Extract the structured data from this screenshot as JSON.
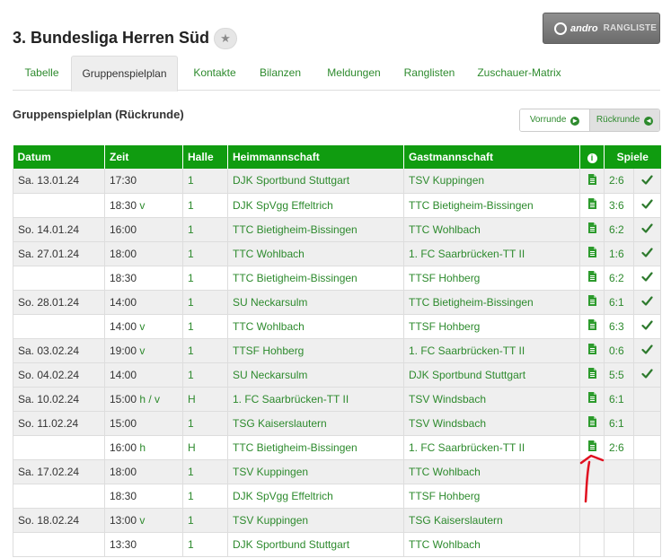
{
  "header": {
    "title": "3. Bundesliga Herren Süd",
    "favorite_glyph": "★",
    "brand_name": "andro",
    "brand_sub": "RANGLISTE"
  },
  "tabs": [
    {
      "label": "Tabelle"
    },
    {
      "label": "Gruppenspielplan"
    },
    {
      "label": "Kontakte"
    },
    {
      "label": "Bilanzen"
    },
    {
      "label": "Meldungen"
    },
    {
      "label": "Ranglisten"
    },
    {
      "label": "Zuschauer-Matrix"
    }
  ],
  "section": {
    "title": "Gruppenspielplan (Rückrunde)",
    "vorrunde": "Vorrunde",
    "rueckrunde": "Rückrunde"
  },
  "table": {
    "headers": {
      "datum": "Datum",
      "zeit": "Zeit",
      "halle": "Halle",
      "heim": "Heimmannschaft",
      "gast": "Gastmannschaft",
      "info": "i",
      "spiele": "Spiele"
    },
    "rows": [
      {
        "date": "Sa. 13.01.24",
        "time": "17:30",
        "flag": "",
        "halle": "1",
        "home": "DJK Sportbund Stuttgart",
        "away": "TSV Kuppingen",
        "report": true,
        "score": "2:6",
        "checked": true
      },
      {
        "date": "",
        "time": "18:30",
        "flag": "v",
        "halle": "1",
        "home": "DJK SpVgg Effeltrich",
        "away": "TTC Bietigheim-Bissingen",
        "report": true,
        "score": "3:6",
        "checked": true
      },
      {
        "date": "So. 14.01.24",
        "time": "16:00",
        "flag": "",
        "halle": "1",
        "home": "TTC Bietigheim-Bissingen",
        "away": "TTC Wohlbach",
        "report": true,
        "score": "6:2",
        "checked": true
      },
      {
        "date": "Sa. 27.01.24",
        "time": "18:00",
        "flag": "",
        "halle": "1",
        "home": "TTC Wohlbach",
        "away": "1. FC Saarbrücken-TT II",
        "report": true,
        "score": "1:6",
        "checked": true
      },
      {
        "date": "",
        "time": "18:30",
        "flag": "",
        "halle": "1",
        "home": "TTC Bietigheim-Bissingen",
        "away": "TTSF Hohberg",
        "report": true,
        "score": "6:2",
        "checked": true
      },
      {
        "date": "So. 28.01.24",
        "time": "14:00",
        "flag": "",
        "halle": "1",
        "home": "SU Neckarsulm",
        "away": "TTC Bietigheim-Bissingen",
        "report": true,
        "score": "6:1",
        "checked": true
      },
      {
        "date": "",
        "time": "14:00",
        "flag": "v",
        "halle": "1",
        "home": "TTC Wohlbach",
        "away": "TTSF Hohberg",
        "report": true,
        "score": "6:3",
        "checked": true
      },
      {
        "date": "Sa. 03.02.24",
        "time": "19:00",
        "flag": "v",
        "halle": "1",
        "home": "TTSF Hohberg",
        "away": "1. FC Saarbrücken-TT II",
        "report": true,
        "score": "0:6",
        "checked": true
      },
      {
        "date": "So. 04.02.24",
        "time": "14:00",
        "flag": "",
        "halle": "1",
        "home": "SU Neckarsulm",
        "away": "DJK Sportbund Stuttgart",
        "report": true,
        "score": "5:5",
        "checked": true
      },
      {
        "date": "Sa. 10.02.24",
        "time": "15:00",
        "flag": "h / v",
        "halle": "H",
        "home": "1. FC Saarbrücken-TT II",
        "away": "TSV Windsbach",
        "report": true,
        "score": "6:1",
        "checked": false
      },
      {
        "date": "So. 11.02.24",
        "time": "15:00",
        "flag": "",
        "halle": "1",
        "home": "TSG Kaiserslautern",
        "away": "TSV Windsbach",
        "report": true,
        "score": "6:1",
        "checked": false
      },
      {
        "date": "",
        "time": "16:00",
        "flag": "h",
        "halle": "H",
        "home": "TTC Bietigheim-Bissingen",
        "away": "1. FC Saarbrücken-TT II",
        "report": true,
        "score": "2:6",
        "checked": false
      },
      {
        "date": "Sa. 17.02.24",
        "time": "18:00",
        "flag": "",
        "halle": "1",
        "home": "TSV Kuppingen",
        "away": "TTC Wohlbach",
        "report": false,
        "score": "",
        "checked": false
      },
      {
        "date": "",
        "time": "18:30",
        "flag": "",
        "halle": "1",
        "home": "DJK SpVgg Effeltrich",
        "away": "TTSF Hohberg",
        "report": false,
        "score": "",
        "checked": false
      },
      {
        "date": "So. 18.02.24",
        "time": "13:00",
        "flag": "v",
        "halle": "1",
        "home": "TSV Kuppingen",
        "away": "TSG Kaiserslautern",
        "report": false,
        "score": "",
        "checked": false
      },
      {
        "date": "",
        "time": "13:30",
        "flag": "",
        "halle": "1",
        "home": "DJK Sportbund Stuttgart",
        "away": "TTC Wohlbach",
        "report": false,
        "score": "",
        "checked": false
      }
    ]
  },
  "colors": {
    "header_green": "#109c10",
    "link_green": "#2d8a2d",
    "annotation_red": "#e01020"
  },
  "icons": [
    "favorite-star-icon",
    "andro-logo-icon",
    "arrow-right-icon",
    "arrow-left-icon",
    "info-icon",
    "document-icon",
    "checkmark-icon",
    "red-annotation-arrow"
  ]
}
